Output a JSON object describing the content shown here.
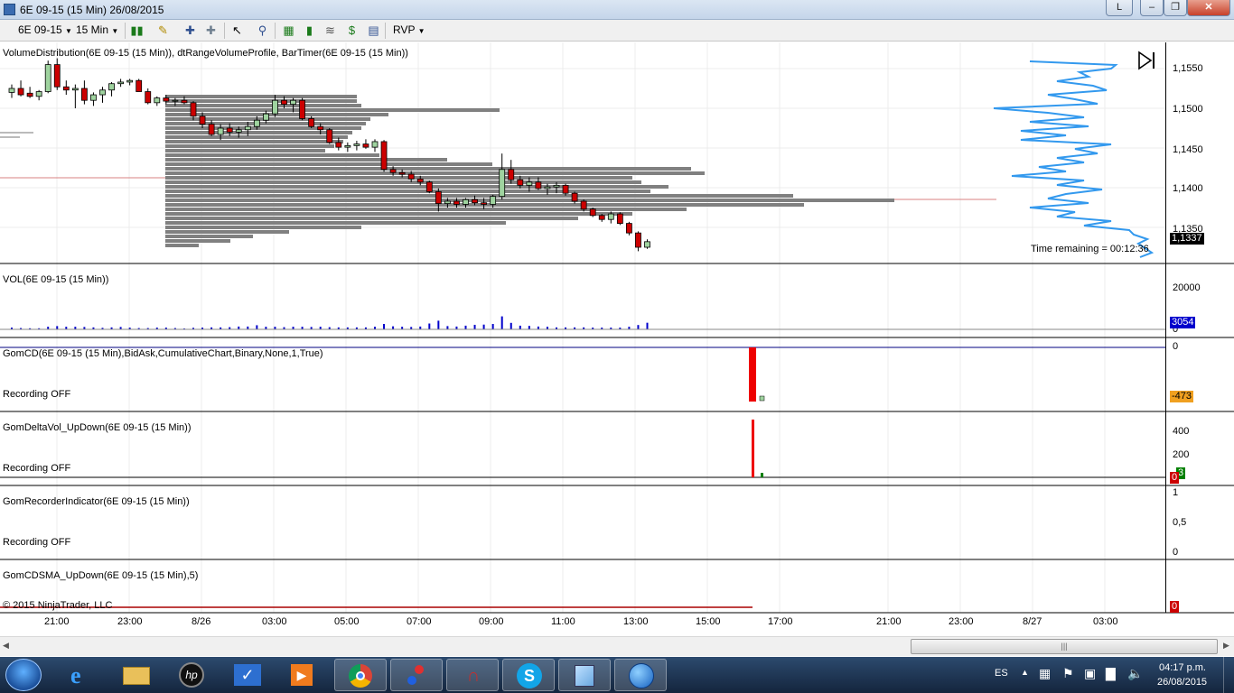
{
  "window": {
    "title": "6E 09-15 (15 Min)  26/08/2015",
    "button_l": "L"
  },
  "toolbar": {
    "instrument": "6E 09-15",
    "interval": "15 Min",
    "template": "RVP"
  },
  "panels": {
    "price": {
      "label": "VolumeDistribution(6E 09-15 (15 Min)), dtRangeVolumeProfile, BarTimer(6E 09-15 (15 Min))",
      "ticks": [
        "1,1550",
        "1,1500",
        "1,1450",
        "1,1400",
        "1,1350"
      ],
      "last_price": "1,1337",
      "time_remaining": "Time remaining = 00:12:36"
    },
    "volume": {
      "label": "VOL(6E 09-15 (15 Min))",
      "ticks": [
        "20000",
        "0"
      ],
      "last_value": "3054"
    },
    "gomcd": {
      "label": "GomCD(6E 09-15 (15 Min),BidAsk,CumulativeChart,Binary,None,1,True)",
      "status": "Recording OFF",
      "ticks": [
        "0"
      ],
      "last_value": "-473"
    },
    "gomdelta": {
      "label": "GomDeltaVol_UpDown(6E 09-15 (15 Min))",
      "status": "Recording OFF",
      "ticks": [
        "400",
        "200"
      ],
      "last_value": "3",
      "zero_value": "0"
    },
    "gomrec": {
      "label": "GomRecorderIndicator(6E 09-15 (15 Min))",
      "status": "Recording OFF",
      "ticks": [
        "1",
        "0,5",
        "0"
      ]
    },
    "gomcdsma": {
      "label": "GomCDSMA_UpDown(6E 09-15 (15 Min),5)",
      "last_value": "0"
    },
    "copyright": "© 2015 NinjaTrader, LLC"
  },
  "time_axis": [
    "21:00",
    "23:00",
    "8/26",
    "03:00",
    "05:00",
    "07:00",
    "09:00",
    "11:00",
    "13:00",
    "15:00",
    "17:00",
    "21:00",
    "23:00",
    "8/27",
    "03:00"
  ],
  "taskbar": {
    "language": "ES",
    "time": "04:17 p.m.",
    "date": "26/08/2015"
  },
  "colors": {
    "up_candle": "#9fd39f",
    "down_candle": "#cc0000",
    "volume_bar": "#0000cc",
    "profile_gray": "#808080",
    "vd_blue": "#3399ee"
  },
  "chart_data": {
    "type": "candlestick",
    "instrument": "6E 09-15",
    "interval": "15 Min",
    "ohlc_approx": [
      [
        1.1525,
        1.1535,
        1.1518,
        1.153
      ],
      [
        1.153,
        1.154,
        1.152,
        1.1522
      ],
      [
        1.1524,
        1.1532,
        1.1518,
        1.152
      ],
      [
        1.152,
        1.1528,
        1.1515,
        1.1526
      ],
      [
        1.1526,
        1.1565,
        1.1524,
        1.156
      ],
      [
        1.156,
        1.1568,
        1.1528,
        1.1532
      ],
      [
        1.1532,
        1.154,
        1.1522,
        1.1528
      ],
      [
        1.1528,
        1.1535,
        1.1505,
        1.153
      ],
      [
        1.153,
        1.154,
        1.151,
        1.1515
      ],
      [
        1.1515,
        1.1525,
        1.1508,
        1.1522
      ],
      [
        1.1522,
        1.1532,
        1.1512,
        1.1528
      ],
      [
        1.1528,
        1.1538,
        1.152,
        1.1536
      ],
      [
        1.1536,
        1.1542,
        1.1532,
        1.1538
      ],
      [
        1.1538,
        1.1542,
        1.1534,
        1.154
      ],
      [
        1.154,
        1.1542,
        1.153,
        1.1526
      ],
      [
        1.1526,
        1.153,
        1.151,
        1.1512
      ],
      [
        1.1512,
        1.152,
        1.1508,
        1.1518
      ],
      [
        1.1518,
        1.1522,
        1.151,
        1.1514
      ],
      [
        1.1514,
        1.1518,
        1.1508,
        1.1515
      ],
      [
        1.1515,
        1.152,
        1.151,
        1.1512
      ],
      [
        1.1512,
        1.1514,
        1.149,
        1.1495
      ],
      [
        1.1495,
        1.15,
        1.148,
        1.1485
      ],
      [
        1.1485,
        1.149,
        1.147,
        1.1472
      ],
      [
        1.1472,
        1.1485,
        1.1465,
        1.148
      ],
      [
        1.148,
        1.1486,
        1.147,
        1.1475
      ],
      [
        1.1475,
        1.1482,
        1.1468,
        1.1478
      ],
      [
        1.1478,
        1.1488,
        1.147,
        1.1482
      ],
      [
        1.1482,
        1.1495,
        1.1478,
        1.149
      ],
      [
        1.149,
        1.1502,
        1.1486,
        1.1498
      ],
      [
        1.1498,
        1.1522,
        1.1494,
        1.1515
      ],
      [
        1.1515,
        1.152,
        1.1505,
        1.151
      ],
      [
        1.151,
        1.1518,
        1.15,
        1.1515
      ],
      [
        1.1515,
        1.1518,
        1.149,
        1.1492
      ],
      [
        1.1492,
        1.1495,
        1.148,
        1.1482
      ],
      [
        1.1482,
        1.1486,
        1.1472,
        1.1478
      ],
      [
        1.1478,
        1.148,
        1.146,
        1.1462
      ],
      [
        1.1462,
        1.1468,
        1.1452,
        1.1456
      ],
      [
        1.1456,
        1.1462,
        1.145,
        1.1458
      ],
      [
        1.1458,
        1.1464,
        1.1452,
        1.146
      ],
      [
        1.146,
        1.1466,
        1.1454,
        1.1456
      ],
      [
        1.1456,
        1.1466,
        1.145,
        1.1463
      ],
      [
        1.1463,
        1.1465,
        1.1425,
        1.1428
      ],
      [
        1.1428,
        1.1432,
        1.142,
        1.1424
      ],
      [
        1.1424,
        1.1428,
        1.1418,
        1.1422
      ],
      [
        1.1422,
        1.1426,
        1.1412,
        1.1416
      ],
      [
        1.1416,
        1.142,
        1.1408,
        1.1412
      ],
      [
        1.1412,
        1.1414,
        1.1398,
        1.14
      ],
      [
        1.14,
        1.1404,
        1.1375,
        1.1385
      ],
      [
        1.1385,
        1.1392,
        1.138,
        1.1388
      ],
      [
        1.1388,
        1.1392,
        1.138,
        1.1384
      ],
      [
        1.1384,
        1.1392,
        1.138,
        1.139
      ],
      [
        1.139,
        1.1395,
        1.1383,
        1.1386
      ],
      [
        1.1386,
        1.1392,
        1.1378,
        1.1384
      ],
      [
        1.1384,
        1.1396,
        1.138,
        1.1394
      ],
      [
        1.1394,
        1.1448,
        1.139,
        1.1428
      ],
      [
        1.1428,
        1.144,
        1.141,
        1.1415
      ],
      [
        1.1415,
        1.142,
        1.1404,
        1.1408
      ],
      [
        1.1408,
        1.1418,
        1.14,
        1.1412
      ],
      [
        1.1412,
        1.1418,
        1.1402,
        1.1404
      ],
      [
        1.1404,
        1.141,
        1.1396,
        1.1406
      ],
      [
        1.1406,
        1.1412,
        1.1398,
        1.1408
      ],
      [
        1.1408,
        1.141,
        1.1395,
        1.1398
      ],
      [
        1.1398,
        1.14,
        1.1385,
        1.1388
      ],
      [
        1.1388,
        1.139,
        1.1375,
        1.1378
      ],
      [
        1.1378,
        1.138,
        1.1368,
        1.137
      ],
      [
        1.137,
        1.1372,
        1.1362,
        1.1365
      ],
      [
        1.1365,
        1.1375,
        1.136,
        1.1372
      ],
      [
        1.1372,
        1.1374,
        1.1358,
        1.136
      ],
      [
        1.136,
        1.1362,
        1.1345,
        1.1348
      ],
      [
        1.1348,
        1.135,
        1.1325,
        1.133
      ],
      [
        1.133,
        1.134,
        1.1328,
        1.1337
      ]
    ],
    "volume_approx": [
      800,
      600,
      500,
      500,
      1200,
      1500,
      1200,
      1200,
      1100,
      900,
      700,
      900,
      1100,
      800,
      600,
      600,
      800,
      800,
      600,
      400,
      700,
      800,
      900,
      900,
      1000,
      1300,
      1300,
      1900,
      1200,
      1200,
      1000,
      1200,
      1200,
      1100,
      1200,
      1000,
      900,
      900,
      900,
      900,
      1200,
      2500,
      1400,
      1200,
      1100,
      1300,
      2700,
      4000,
      1500,
      1300,
      1700,
      2100,
      2200,
      2500,
      6000,
      3000,
      1700,
      1600,
      1300,
      1200,
      900,
      900,
      900,
      900,
      800,
      800,
      800,
      800,
      1200,
      2000,
      3054
    ]
  }
}
